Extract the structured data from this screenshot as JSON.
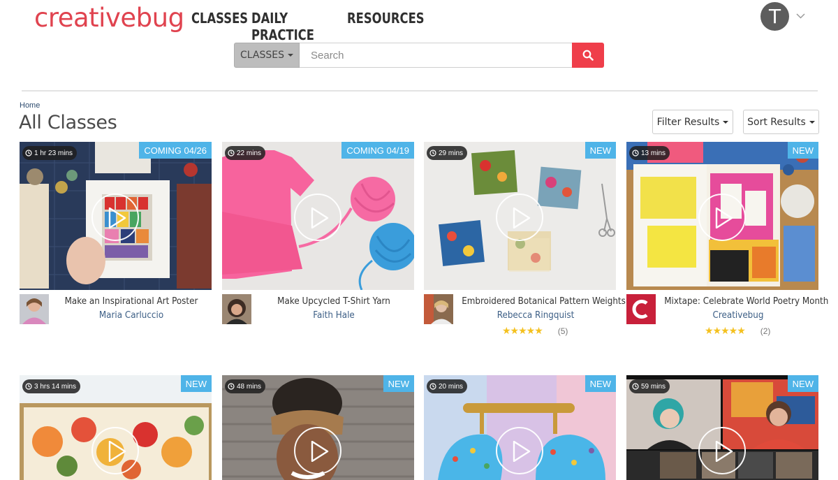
{
  "header": {
    "logo": "creativebug",
    "nav": [
      "CLASSES",
      "DAILY PRACTICE",
      "RESOURCES"
    ],
    "avatar_letter": "T"
  },
  "search": {
    "type_label": "CLASSES",
    "placeholder": "Search"
  },
  "breadcrumb": "Home",
  "page_title": "All Classes",
  "filter_label": "Filter Results",
  "sort_label": "Sort Results",
  "colors": {
    "brand": "#e0434f",
    "search_button": "#ef3e4a",
    "badge": "#4fb4e8",
    "link": "#3d5f86",
    "star": "#f4c120"
  },
  "cards": [
    {
      "duration": "1 hr 23 mins",
      "badge": "COMING 04/26",
      "title": "Make an Inspirational Art Poster",
      "instructor": "Maria Carluccio",
      "stars": "",
      "rating_count": ""
    },
    {
      "duration": "22 mins",
      "badge": "COMING 04/19",
      "title": "Make Upcycled T-Shirt Yarn",
      "instructor": "Faith Hale",
      "stars": "",
      "rating_count": ""
    },
    {
      "duration": "29 mins",
      "badge": "NEW",
      "title": "Embroidered Botanical Pattern Weights",
      "instructor": "Rebecca Ringquist",
      "stars": "★★★★★",
      "rating_count": "(5)"
    },
    {
      "duration": "13 mins",
      "badge": "NEW",
      "title": "Mixtape: Celebrate World Poetry Month",
      "instructor": "Creativebug",
      "stars": "★★★★★",
      "rating_count": "(2)"
    },
    {
      "duration": "3 hrs 14 mins",
      "badge": "NEW"
    },
    {
      "duration": "48 mins",
      "badge": "NEW"
    },
    {
      "duration": "20 mins",
      "badge": "NEW"
    },
    {
      "duration": "59 mins",
      "badge": "NEW"
    }
  ]
}
